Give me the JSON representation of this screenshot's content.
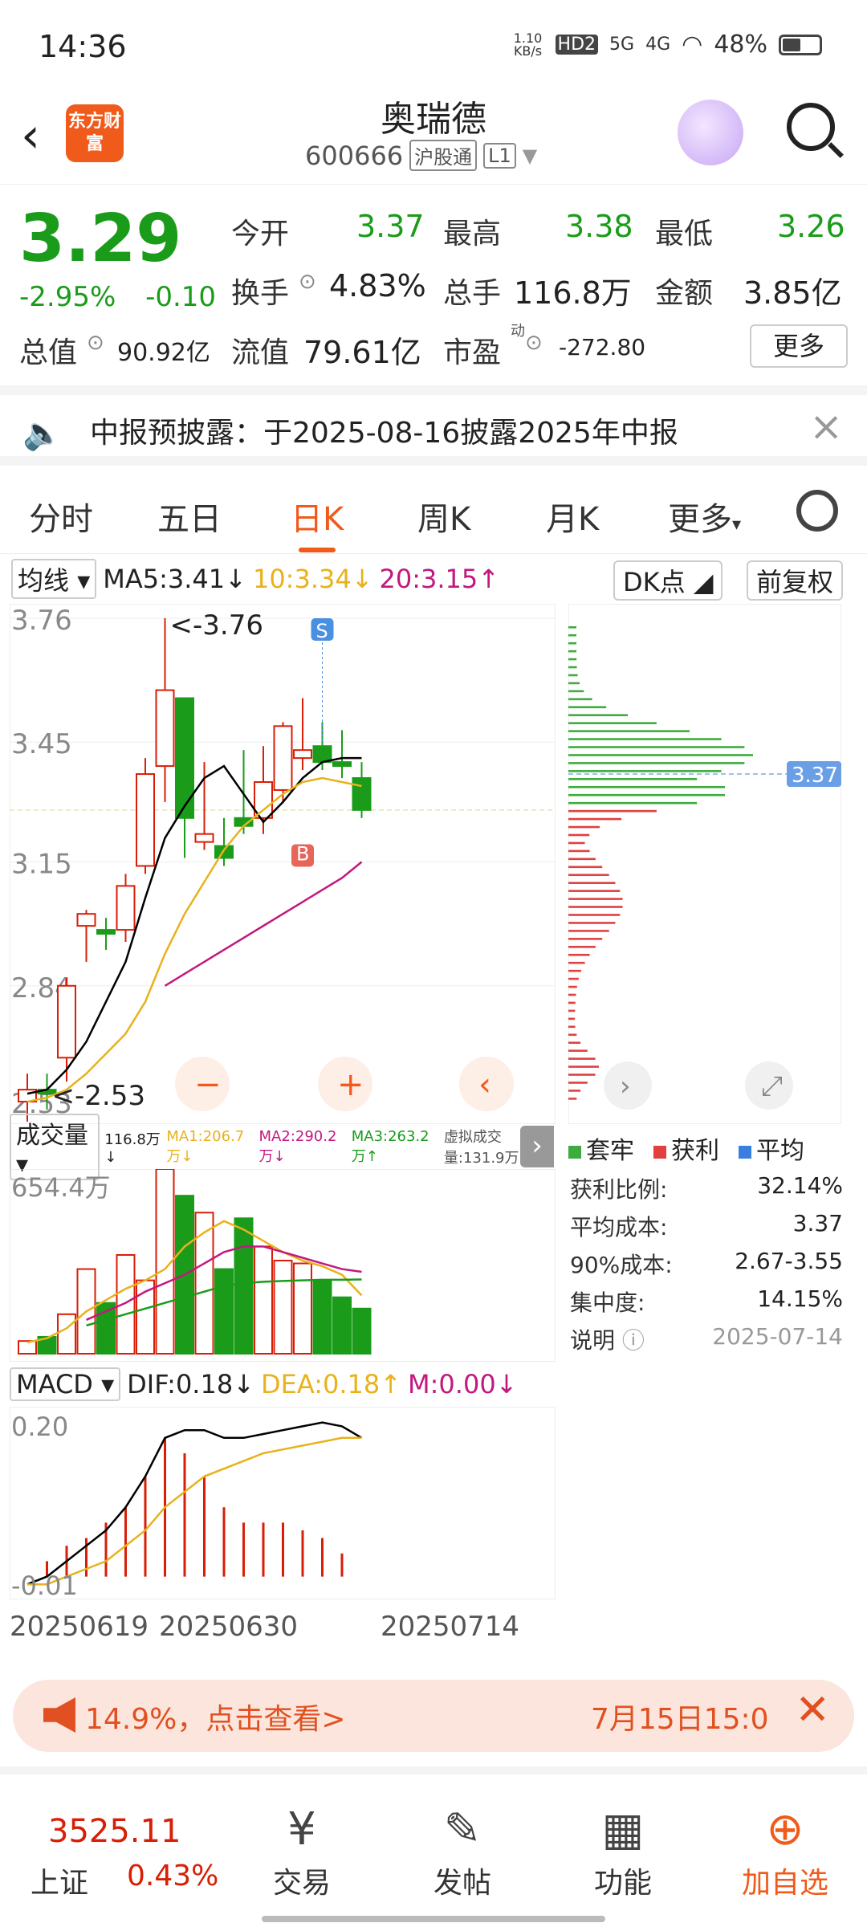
{
  "status_bar": {
    "time": "14:36",
    "net_speed": "1.10 KB/s",
    "hd": "HD2",
    "net1": "5G",
    "net2": "4G",
    "battery": "48%"
  },
  "header": {
    "logo_text": "东方财富",
    "name": "奥瑞德",
    "code": "600666",
    "tag1": "沪股通",
    "tag2": "L1"
  },
  "quote": {
    "price": "3.29",
    "change_pct": "-2.95%",
    "change": "-0.10",
    "open_label": "今开",
    "open": "3.37",
    "high_label": "最高",
    "high": "3.38",
    "low_label": "最低",
    "low": "3.26",
    "turnover_label": "换手",
    "turnover": "4.83%",
    "volume_label": "总手",
    "volume": "116.8万",
    "amount_label": "金额",
    "amount": "3.85亿",
    "mktcap_label": "总值",
    "mktcap": "90.92亿",
    "float_label": "流值",
    "float": "79.61亿",
    "pe_label": "市盈",
    "pe_sup": "动",
    "pe": "-272.80",
    "more": "更多"
  },
  "notice": {
    "text": "中报预披露：于2025-08-16披露2025年中报"
  },
  "tabs": [
    "分时",
    "五日",
    "日K",
    "周K",
    "月K",
    "更多"
  ],
  "active_tab": "日K",
  "ma": {
    "selector": "均线",
    "ma5": "MA5:3.41↓",
    "ma10": "10:3.34↓",
    "ma20": "20:3.15↑",
    "dk": "DK点",
    "fq": "前复权"
  },
  "kchart": {
    "y_labels": [
      "3.76",
      "3.45",
      "3.15",
      "2.84",
      "2.53"
    ],
    "max_label": "<-3.76",
    "min_label": "<-2.53",
    "s_mark": "S",
    "b_mark": "B"
  },
  "chip": {
    "avg_price": "3.37",
    "legend": [
      "套牢",
      "获利",
      "平均"
    ],
    "stats": [
      {
        "label": "获利比例:",
        "value": "32.14%"
      },
      {
        "label": "平均成本:",
        "value": "3.37"
      },
      {
        "label": "90%成本:",
        "value": "2.67-3.55"
      },
      {
        "label": "集中度:",
        "value": "14.15%"
      }
    ],
    "note_label": "说明",
    "note_date": "2025-07-14"
  },
  "volume": {
    "selector": "成交量",
    "vol": "116.8万↓",
    "ma1": "MA1:206.7万↓",
    "ma2": "MA2:290.2万↓",
    "ma3": "MA3:263.2万↑",
    "virt": "虚拟成交量:131.9万",
    "y_label": "654.4万"
  },
  "macd": {
    "selector": "MACD",
    "dif": "DIF:0.18↓",
    "dea": "DEA:0.18↑",
    "m": "M:0.00↓",
    "y_top": "0.20",
    "y_bot": "-0.01"
  },
  "dates": [
    "20250619",
    "20250630",
    "20250714"
  ],
  "banner": {
    "left": "14.9%，点击查看>",
    "right": "7月15日15:0"
  },
  "bottom": {
    "index_name": "上证",
    "index_val": "3525.11",
    "index_chg": "0.43%",
    "nav": [
      "交易",
      "发帖",
      "功能",
      "加自选"
    ]
  },
  "colors": {
    "up": "#d81e06",
    "down": "#1a9c1a",
    "accent": "#f05a1a",
    "ma5": "#000000",
    "ma10": "#e8b21c",
    "ma20": "#c2187f"
  },
  "candles": [
    {
      "o": 2.55,
      "h": 2.62,
      "l": 2.5,
      "c": 2.58
    },
    {
      "o": 2.58,
      "h": 2.62,
      "l": 2.53,
      "c": 2.57
    },
    {
      "o": 2.66,
      "h": 2.86,
      "l": 2.6,
      "c": 2.84
    },
    {
      "o": 2.99,
      "h": 3.03,
      "l": 2.9,
      "c": 3.02
    },
    {
      "o": 2.98,
      "h": 3.01,
      "l": 2.93,
      "c": 2.97
    },
    {
      "o": 2.98,
      "h": 3.12,
      "l": 2.95,
      "c": 3.09
    },
    {
      "o": 3.14,
      "h": 3.41,
      "l": 3.12,
      "c": 3.37
    },
    {
      "o": 3.39,
      "h": 3.76,
      "l": 3.3,
      "c": 3.58
    },
    {
      "o": 3.56,
      "h": 3.56,
      "l": 3.16,
      "c": 3.26
    },
    {
      "o": 3.2,
      "h": 3.4,
      "l": 3.18,
      "c": 3.22
    },
    {
      "o": 3.19,
      "h": 3.26,
      "l": 3.14,
      "c": 3.16
    },
    {
      "o": 3.26,
      "h": 3.43,
      "l": 3.22,
      "c": 3.24
    },
    {
      "o": 3.26,
      "h": 3.44,
      "l": 3.22,
      "c": 3.35
    },
    {
      "o": 3.33,
      "h": 3.5,
      "l": 3.3,
      "c": 3.49
    },
    {
      "o": 3.41,
      "h": 3.56,
      "l": 3.38,
      "c": 3.43
    },
    {
      "o": 3.44,
      "h": 3.5,
      "l": 3.38,
      "c": 3.4
    },
    {
      "o": 3.4,
      "h": 3.48,
      "l": 3.36,
      "c": 3.39
    },
    {
      "o": 3.36,
      "h": 3.4,
      "l": 3.26,
      "c": 3.28
    }
  ],
  "ma5_line": [
    2.57,
    2.58,
    2.63,
    2.7,
    2.8,
    2.9,
    3.06,
    3.21,
    3.29,
    3.36,
    3.39,
    3.32,
    3.25,
    3.3,
    3.36,
    3.4,
    3.41,
    3.41
  ],
  "ma10_line": [
    2.55,
    2.56,
    2.58,
    2.62,
    2.67,
    2.72,
    2.8,
    2.92,
    3.02,
    3.1,
    3.18,
    3.24,
    3.28,
    3.32,
    3.35,
    3.36,
    3.35,
    3.34
  ],
  "ma20_line": [
    null,
    null,
    null,
    null,
    null,
    null,
    null,
    2.84,
    2.87,
    2.9,
    2.93,
    2.96,
    2.99,
    3.02,
    3.05,
    3.08,
    3.11,
    3.15
  ],
  "volumes": [
    45,
    60,
    140,
    300,
    180,
    350,
    260,
    654.4,
    560,
    500,
    300,
    480,
    380,
    330,
    320,
    260,
    200,
    160
  ],
  "vol_ma1": [
    40,
    55,
    90,
    150,
    190,
    230,
    260,
    300,
    380,
    430,
    470,
    440,
    400,
    360,
    330,
    310,
    280,
    206.7
  ],
  "vol_ma2": [
    null,
    null,
    null,
    120,
    150,
    180,
    220,
    250,
    280,
    320,
    360,
    380,
    380,
    360,
    340,
    320,
    300,
    290.2
  ],
  "vol_ma3": [
    null,
    null,
    null,
    100,
    120,
    140,
    160,
    180,
    200,
    220,
    240,
    250,
    255,
    258,
    260,
    262,
    262,
    263.2
  ],
  "dif_line": [
    -0.01,
    0.0,
    0.02,
    0.04,
    0.06,
    0.09,
    0.13,
    0.18,
    0.19,
    0.19,
    0.18,
    0.18,
    0.185,
    0.19,
    0.195,
    0.2,
    0.195,
    0.18
  ],
  "dea_line": [
    -0.01,
    -0.01,
    0.0,
    0.01,
    0.02,
    0.04,
    0.06,
    0.09,
    0.11,
    0.13,
    0.14,
    0.15,
    0.16,
    0.165,
    0.17,
    0.175,
    0.18,
    0.18
  ],
  "macd_hist": [
    0.0,
    0.02,
    0.04,
    0.05,
    0.07,
    0.09,
    0.13,
    0.18,
    0.16,
    0.13,
    0.09,
    0.07,
    0.07,
    0.07,
    0.06,
    0.05,
    0.03,
    0.0
  ]
}
